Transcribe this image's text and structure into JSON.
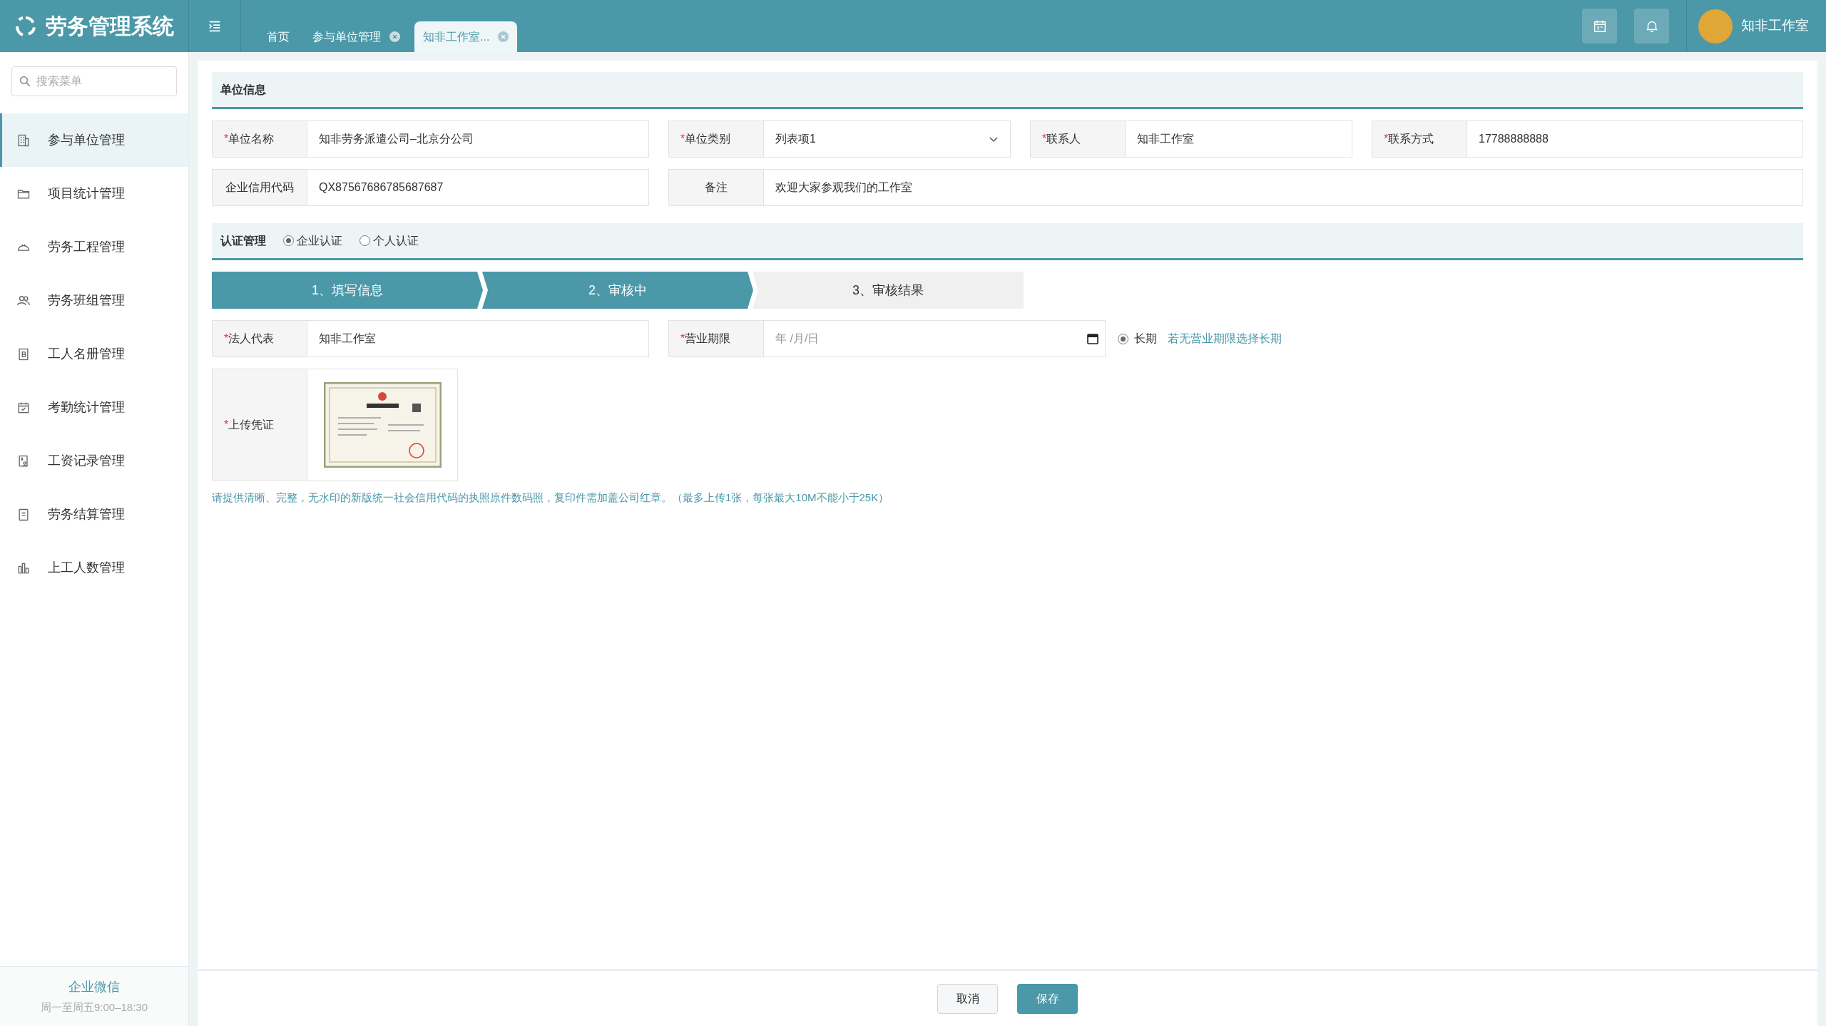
{
  "app": {
    "title": "劳务管理系统"
  },
  "tabs": [
    {
      "label": "首页",
      "closable": false,
      "selected": false
    },
    {
      "label": "参与单位管理",
      "closable": true,
      "selected": false
    },
    {
      "label": "知非工作室...",
      "closable": true,
      "selected": true
    }
  ],
  "user": {
    "name": "知非工作室"
  },
  "sidebar": {
    "search_placeholder": "搜索菜单",
    "items": [
      {
        "label": "参与单位管理",
        "kind": "building",
        "selected": true
      },
      {
        "label": "项目统计管理",
        "kind": "folder",
        "selected": false
      },
      {
        "label": "劳务工程管理",
        "kind": "helmet",
        "selected": false
      },
      {
        "label": "劳务班组管理",
        "kind": "users",
        "selected": false
      },
      {
        "label": "工人名册管理",
        "kind": "book",
        "selected": false
      },
      {
        "label": "考勤统计管理",
        "kind": "calendar",
        "selected": false
      },
      {
        "label": "工资记录管理",
        "kind": "payroll",
        "selected": false
      },
      {
        "label": "劳务结算管理",
        "kind": "doc",
        "selected": false
      },
      {
        "label": "上工人数管理",
        "kind": "chart",
        "selected": false
      }
    ],
    "footer": {
      "title": "企业微信",
      "hours": "周一至周五9:00–18:30"
    }
  },
  "unit_info": {
    "title": "单位信息",
    "rows": [
      [
        {
          "required_mark": "*",
          "label": "单位名称",
          "value": "知非劳务派遣公司–北京分公司",
          "kind": "text"
        },
        {
          "required_mark": "*",
          "label": "单位类别",
          "value": "列表项1",
          "kind": "select"
        },
        {
          "required_mark": "*",
          "label": "联系人",
          "value": "知非工作室",
          "kind": "text"
        },
        {
          "required_mark": "*",
          "label": "联系方式",
          "value": "17788888888",
          "kind": "text"
        }
      ],
      [
        {
          "label": "企业信用代码",
          "value": "QX87567686785687687",
          "kind": "text"
        },
        {
          "label": "备注",
          "value": "欢迎大家参观我们的工作室",
          "kind": "text"
        }
      ]
    ]
  },
  "certification": {
    "title": "认证管理",
    "options": [
      {
        "label": "企业认证",
        "selected": true
      },
      {
        "label": "个人认证",
        "selected": false
      }
    ],
    "steps": [
      {
        "label": "1、填写信息",
        "done": true
      },
      {
        "label": "2、审核中",
        "done": true
      },
      {
        "label": "3、审核结果",
        "done": false
      }
    ],
    "legal_rep": {
      "required_mark": "*",
      "label": "法人代表",
      "value": "知非工作室"
    },
    "business_term": {
      "required_mark": "*",
      "label": "营业期限",
      "placeholder": "年 /月/日",
      "long_term": {
        "label": "长期",
        "checked": true
      },
      "hint": "若无营业期限选择长期"
    },
    "upload": {
      "required_mark": "*",
      "label": "上传凭证"
    },
    "note": "请提供清晰、完整，无水印的新版统一社会信用代码的执照原件数码照，复印件需加盖公司红章。（最多上传1张，每张最大10M不能小于25K）"
  },
  "actions": [
    {
      "label": "取消",
      "kind": "secondary"
    },
    {
      "label": "保存",
      "kind": "primary"
    }
  ]
}
